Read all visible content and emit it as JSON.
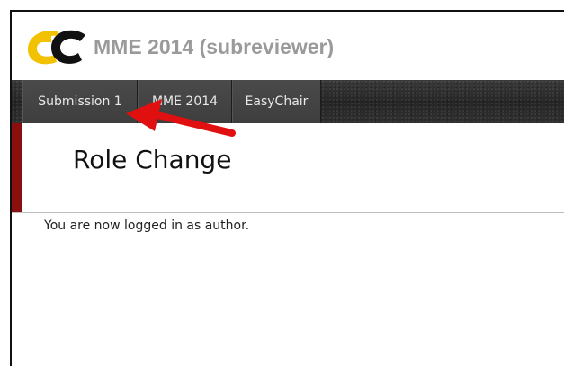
{
  "header": {
    "title": "MME 2014 (subreviewer)",
    "logo_icon": "easychair-logo-icon",
    "logo_colors": {
      "e": "#f2c200",
      "c": "#111111"
    }
  },
  "nav": {
    "tabs": [
      {
        "label": "Submission 1"
      },
      {
        "label": "MME 2014"
      },
      {
        "label": "EasyChair"
      }
    ]
  },
  "page": {
    "title": "Role Change",
    "message": "You are now logged in as author."
  },
  "annotation": {
    "icon": "red-arrow-icon",
    "color": "#e01010"
  }
}
